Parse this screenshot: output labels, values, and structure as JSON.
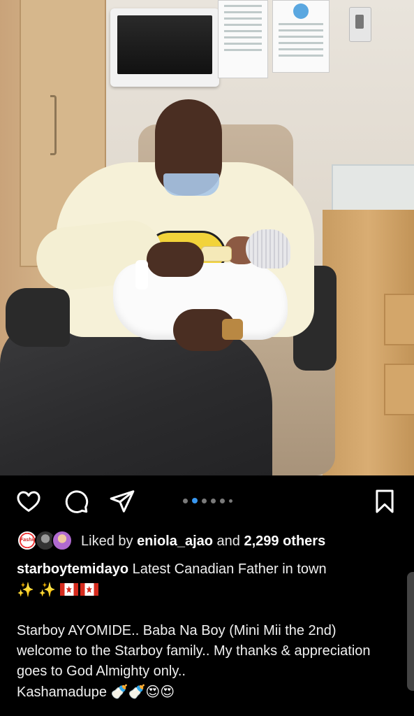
{
  "post": {
    "carousel": {
      "count": 6,
      "active_index": 1
    },
    "actions": {
      "like_icon": "heart-outline-icon",
      "comment_icon": "comment-bubble-icon",
      "share_icon": "paper-plane-icon",
      "save_icon": "bookmark-icon"
    },
    "likes": {
      "prefix": "Liked by ",
      "user": "eniola_ajao",
      "middle": " and ",
      "count": "2,299 others",
      "avatar1_text": "Fashion"
    },
    "caption": {
      "username": "starboytemidayo",
      "text": " Latest Canadian Father in town",
      "line2_emoji": "✨ ✨",
      "para1": "Starboy AYOMIDE.. Baba Na Boy (Mini Mii the 2nd) welcome to the Starboy family.. My thanks & appreciation goes to God Almighty only..",
      "para2": "Kashamadupe",
      "para2_emoji": "🍼🍼😍😍"
    },
    "colors": {
      "accent": "#3897f0",
      "background": "#000000",
      "text": "#ffffff"
    }
  }
}
